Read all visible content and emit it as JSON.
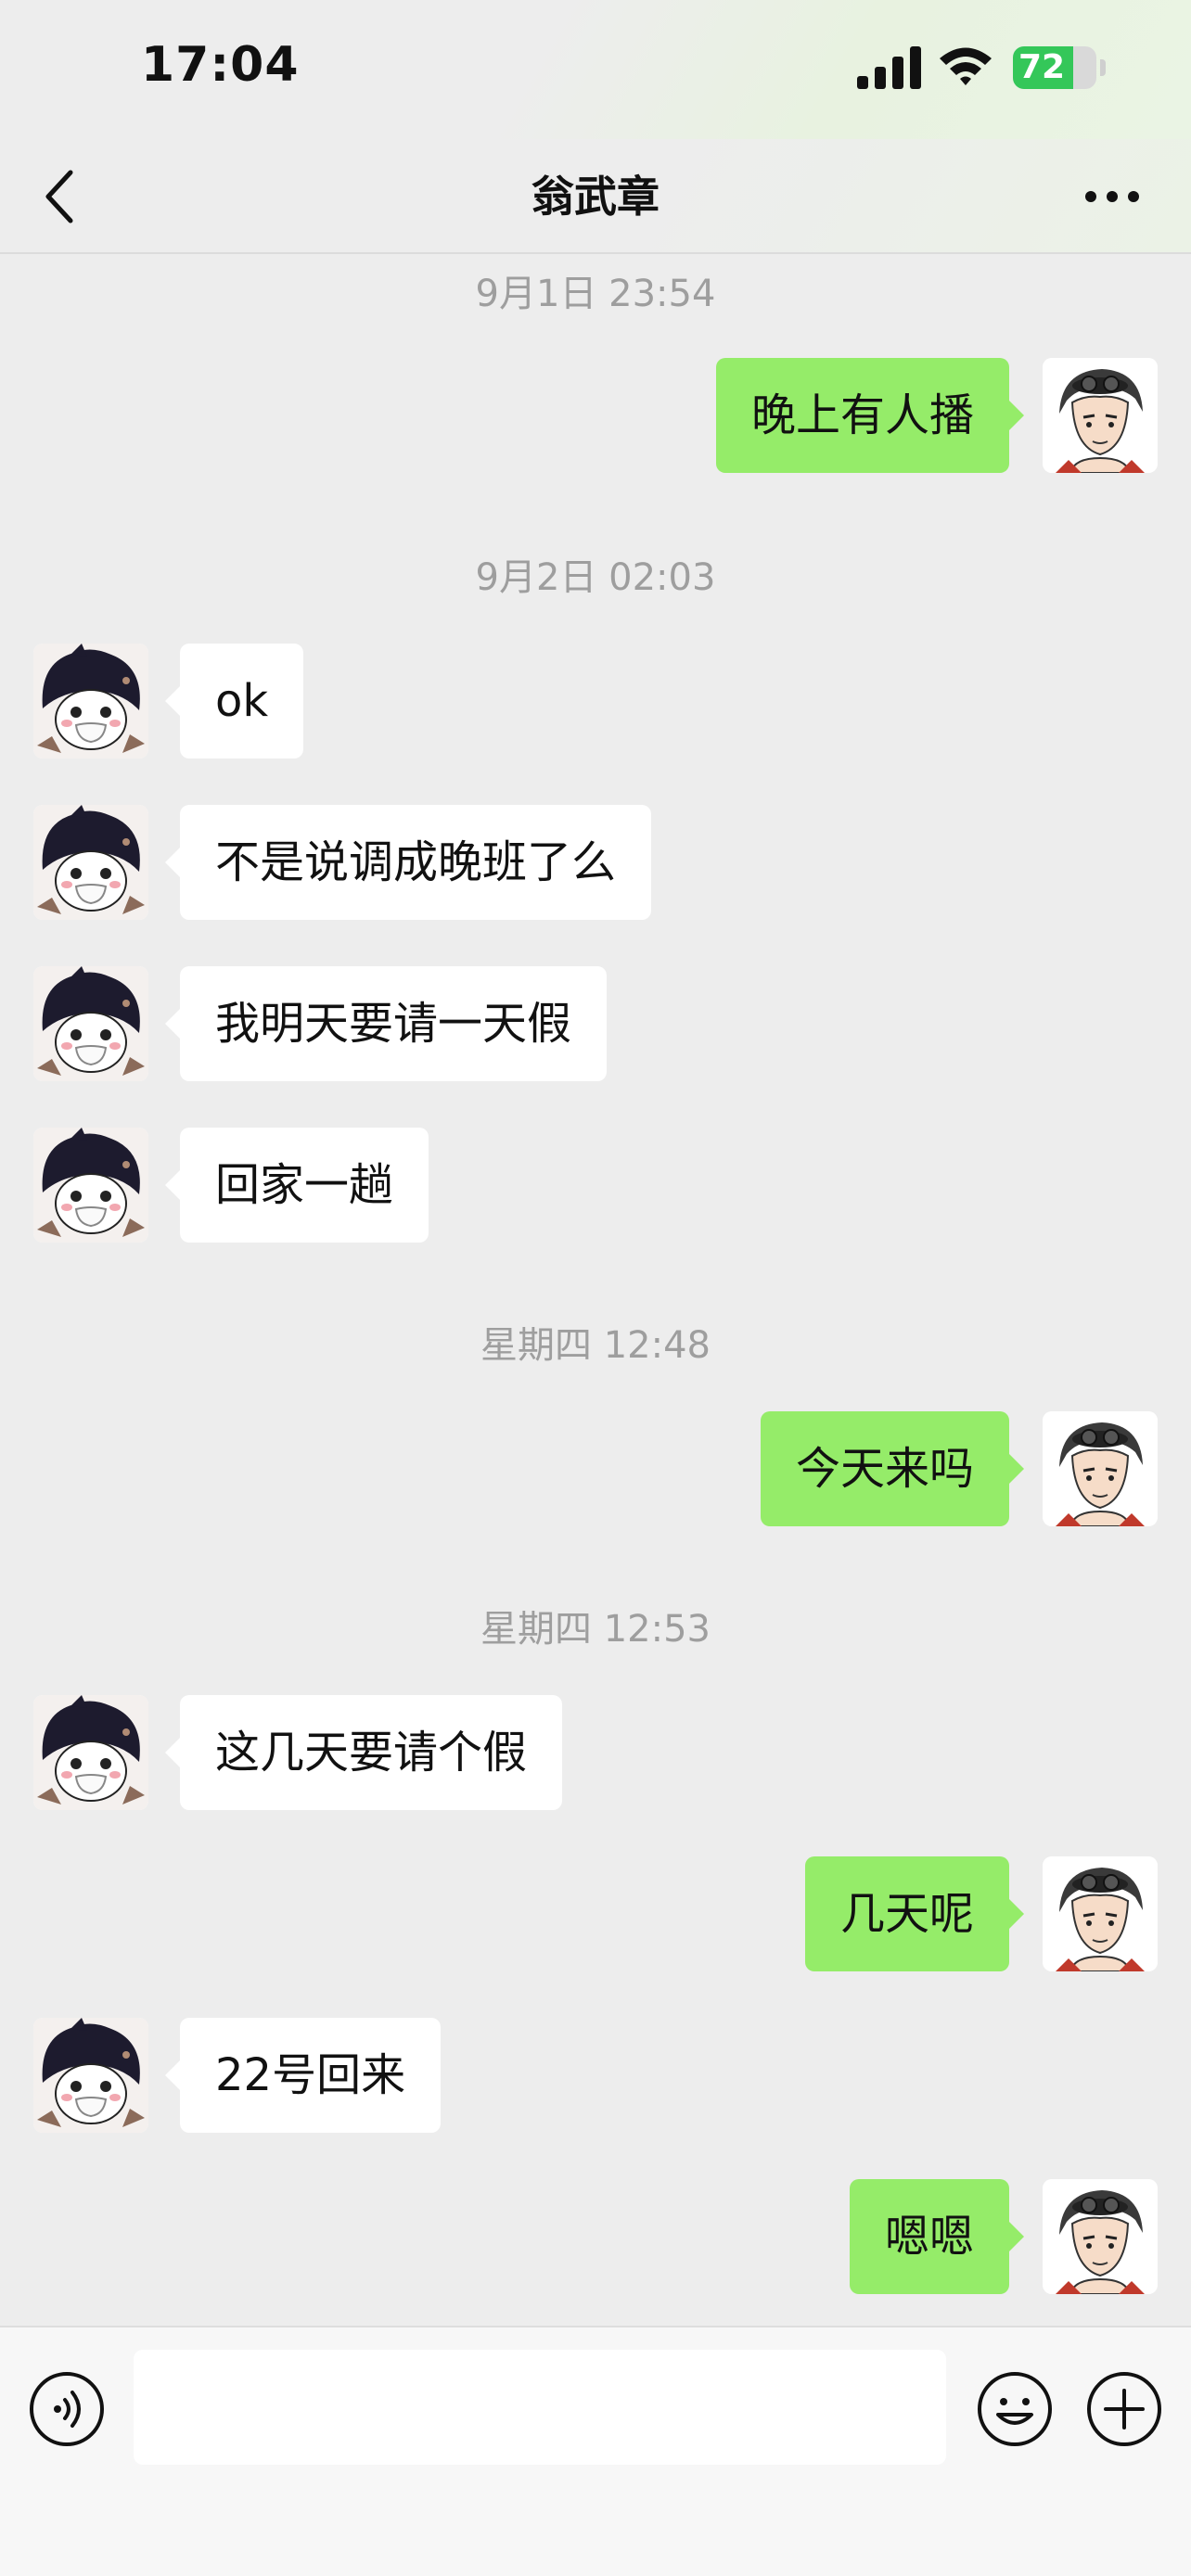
{
  "status_bar": {
    "time": "17:04",
    "battery": "72",
    "battery_level": 0.72
  },
  "nav": {
    "title": "翁武章"
  },
  "messages": [
    {
      "type": "timestamp",
      "text": "9月1日 23:54"
    },
    {
      "type": "out",
      "text": "晚上有人播"
    },
    {
      "type": "timestamp",
      "text": "9月2日 02:03"
    },
    {
      "type": "in",
      "text": "ok"
    },
    {
      "type": "in",
      "text": "不是说调成晚班了么"
    },
    {
      "type": "in",
      "text": "我明天要请一天假"
    },
    {
      "type": "in",
      "text": "回家一趟"
    },
    {
      "type": "timestamp",
      "text": "星期四 12:48"
    },
    {
      "type": "out",
      "text": "今天来吗"
    },
    {
      "type": "timestamp",
      "text": "星期四 12:53"
    },
    {
      "type": "in",
      "text": "这几天要请个假"
    },
    {
      "type": "out",
      "text": "几天呢"
    },
    {
      "type": "in",
      "text": "22号回来"
    },
    {
      "type": "out",
      "text": "嗯嗯"
    }
  ],
  "input": {
    "value": ""
  },
  "colors": {
    "outgoing_bubble": "#95ec69",
    "incoming_bubble": "#ffffff",
    "background": "#ededed",
    "battery": "#34c759"
  },
  "icons": [
    "back-chevron-icon",
    "more-dots-icon",
    "voice-icon",
    "emoji-icon",
    "plus-icon",
    "signal-icon",
    "wifi-icon",
    "battery-icon"
  ]
}
